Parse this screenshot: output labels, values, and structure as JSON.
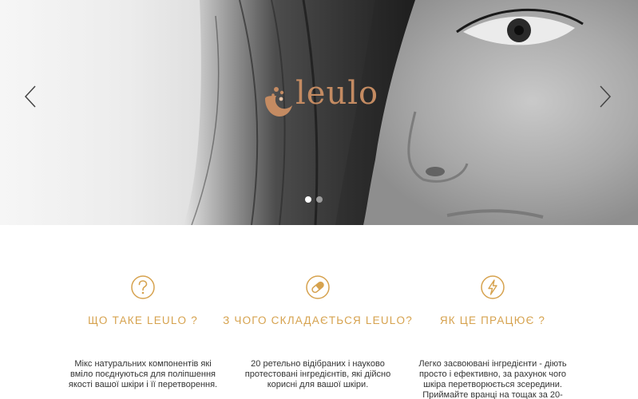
{
  "hero": {
    "logo_text": "leulo",
    "slides": {
      "active": 1,
      "total": 2
    },
    "prev_icon": "chevron-left-icon",
    "next_icon": "chevron-right-icon"
  },
  "features": [
    {
      "icon": "question-circle-icon",
      "title": "ЩО ТАКЕ LEULO ?",
      "text": "Мікс натуральних компонентів які вміло поєднуються для поліпшення якості вашої шкіри і її перетворення."
    },
    {
      "icon": "pill-circle-icon",
      "title": "З ЧОГО СКЛАДАЄТЬСЯ LEULO?",
      "text": "20 ретельно відібраних і науково протестовані інгредієнтів, які дійсно корисні для вашої шкіри."
    },
    {
      "icon": "lightning-circle-icon",
      "title": "ЯК ЦЕ ПРАЦЮЄ ?",
      "text": "Легко засвоювані інгредієнти - діють просто і ефективно, за рахунок чого шкіра перетворюється зсередини. Приймайте вранці на тощак за 20-"
    }
  ],
  "colors": {
    "accent": "#d6a24e",
    "logo": "#c48b62"
  }
}
